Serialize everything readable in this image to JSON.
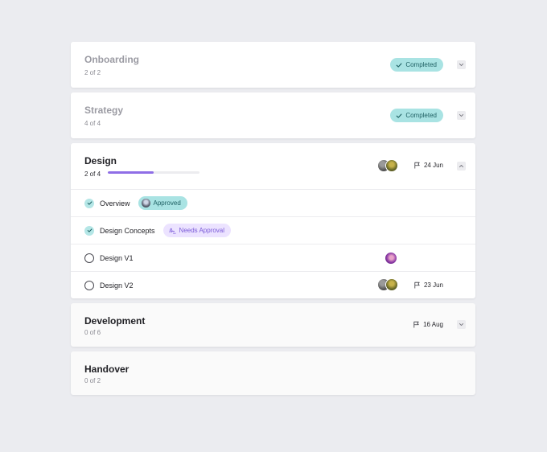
{
  "colors": {
    "page_bg": "#ebecf0",
    "completed_badge_bg": "#a9e3e3",
    "completed_badge_text": "#1d5f62",
    "progress_accent": "#8f6ee6",
    "needs_approval_bg": "#ece3ff",
    "needs_approval_text": "#7a5ad8"
  },
  "phases": [
    {
      "title": "Onboarding",
      "progress_text": "2 of 2",
      "status": "Completed",
      "state": "completed"
    },
    {
      "title": "Strategy",
      "progress_text": "4 of 4",
      "status": "Completed",
      "state": "completed"
    },
    {
      "title": "Design",
      "progress_text": "2 of 4",
      "progress_fraction": 0.5,
      "due": "24 Jun",
      "state": "expanded",
      "tasks": [
        {
          "label": "Overview",
          "done": true,
          "badge": "Approved",
          "badge_type": "approved"
        },
        {
          "label": "Design Concepts",
          "done": true,
          "badge": "Needs Approval",
          "badge_type": "needs-approval"
        },
        {
          "label": "Design V1",
          "done": false
        },
        {
          "label": "Design V2",
          "done": false,
          "due": "23 Jun"
        }
      ]
    },
    {
      "title": "Development",
      "progress_text": "0 of 6",
      "due": "16 Aug",
      "state": "collapsed"
    },
    {
      "title": "Handover",
      "progress_text": "0 of 2",
      "state": "collapsed"
    }
  ],
  "icons": {
    "expand": "chevron-down-icon",
    "collapse": "chevron-up-icon",
    "check": "check-icon",
    "due": "flag-icon",
    "needs_approval": "signature-icon"
  }
}
